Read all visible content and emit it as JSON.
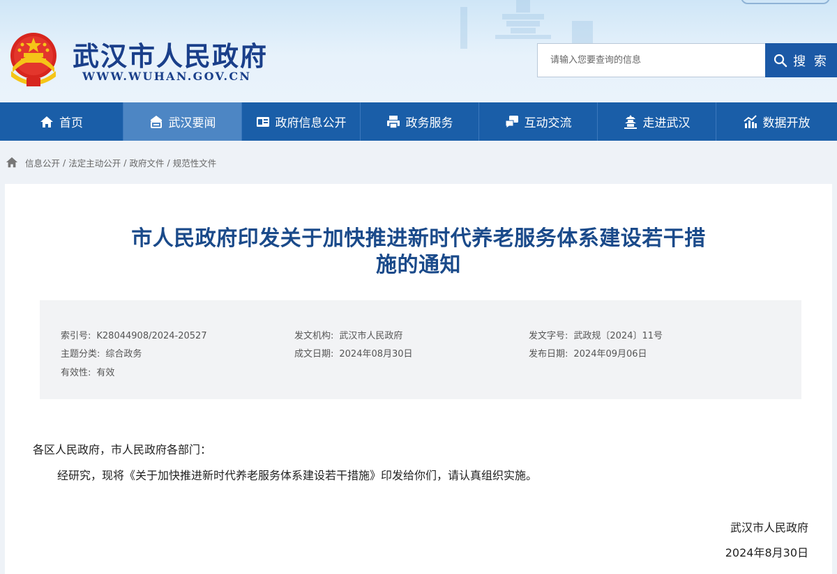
{
  "header": {
    "site_name": "武汉市人民政府",
    "site_url": "WWW.WUHAN.GOV.CN",
    "search_placeholder": "请输入您要查询的信息",
    "search_label": "搜 索"
  },
  "nav": {
    "items": [
      {
        "label": "首页",
        "icon": "home-icon"
      },
      {
        "label": "武汉要闻",
        "icon": "news-icon"
      },
      {
        "label": "政府信息公开",
        "icon": "id-card-icon"
      },
      {
        "label": "政务服务",
        "icon": "printer-icon"
      },
      {
        "label": "互动交流",
        "icon": "chat-icon"
      },
      {
        "label": "走进武汉",
        "icon": "pagoda-icon"
      },
      {
        "label": "数据开放",
        "icon": "chart-icon"
      }
    ],
    "active_index": 1
  },
  "breadcrumb": [
    "信息公开",
    "法定主动公开",
    "政府文件",
    "规范性文件"
  ],
  "article": {
    "title_line1": "市人民政府印发关于加快推进新时代养老服务体系建设若干措",
    "title_line2": "施的通知",
    "meta": {
      "index_no_label": "索引号:",
      "index_no": "K28044908/2024-20527",
      "issuer_label": "发文机构:",
      "issuer": "武汉市人民政府",
      "doc_no_label": "发文字号:",
      "doc_no": "武政规〔2024〕11号",
      "topic_label": "主题分类:",
      "topic": "综合政务",
      "created_label": "成文日期:",
      "created": "2024年08月30日",
      "published_label": "发布日期:",
      "published": "2024年09月06日",
      "validity_label": "有效性:",
      "validity": "有效"
    },
    "salutation": "各区人民政府，市人民政府各部门：",
    "body": "经研究，现将《关于加快推进新时代养老服务体系建设若干措施》印发给你们，请认真组织实施。",
    "signer": "武汉市人民政府",
    "date": "2024年8月30日"
  },
  "colors": {
    "nav_bg": "#1a5ea8",
    "nav_active": "#4d86c4",
    "title": "#1a4a8a",
    "search_btn": "#1b59a6"
  }
}
